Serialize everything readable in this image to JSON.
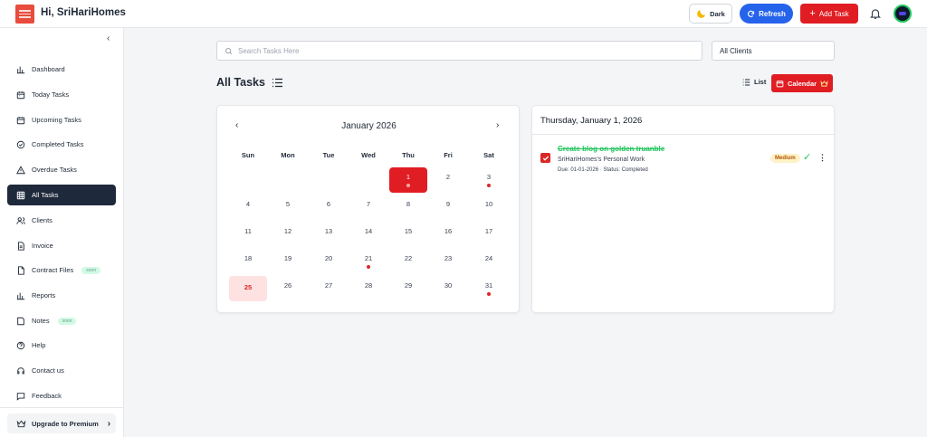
{
  "header": {
    "greeting": "Hi, SriHariHomes",
    "dark_label": "Dark",
    "refresh_label": "Refresh",
    "add_task_label": "Add Task",
    "brand_color": "#e11d24",
    "refresh_color": "#2563eb"
  },
  "sidebar": {
    "items": [
      {
        "label": "Dashboard",
        "icon": "bar-chart-icon"
      },
      {
        "label": "Today Tasks",
        "icon": "calendar-day-icon"
      },
      {
        "label": "Upcoming Tasks",
        "icon": "calendar-icon"
      },
      {
        "label": "Completed Tasks",
        "icon": "check-circle-icon"
      },
      {
        "label": "Overdue Tasks",
        "icon": "warning-icon"
      },
      {
        "label": "All Tasks",
        "icon": "grid-icon",
        "active": true
      },
      {
        "label": "Clients",
        "icon": "users-icon"
      },
      {
        "label": "Invoice",
        "icon": "file-text-icon"
      },
      {
        "label": "Contract Files",
        "icon": "file-icon",
        "badge": "soon"
      },
      {
        "label": "Reports",
        "icon": "bar-chart-icon"
      },
      {
        "label": "Notes",
        "icon": "note-icon",
        "badge": "soon"
      },
      {
        "label": "Help",
        "icon": "help-icon"
      },
      {
        "label": "Contact us",
        "icon": "headset-icon"
      },
      {
        "label": "Feedback",
        "icon": "message-icon"
      }
    ],
    "upgrade_label": "Upgrade to Premium"
  },
  "toolbar": {
    "search_placeholder": "Search Tasks Here",
    "client_filter": "All Clients",
    "page_title": "All Tasks",
    "list_label": "List",
    "calendar_label": "Calendar"
  },
  "calendar": {
    "month_label": "January 2026",
    "weekdays": [
      "Sun",
      "Mon",
      "Tue",
      "Wed",
      "Thu",
      "Fri",
      "Sat"
    ],
    "first_weekday_index": 4,
    "days_in_month": 31,
    "selected_day": 1,
    "highlighted_day": 25,
    "days_with_tasks": [
      1,
      3,
      21,
      31
    ]
  },
  "tasks_panel": {
    "date_heading": "Thursday, January 1, 2026",
    "task": {
      "title": "Create blog on golden truanble",
      "client": "SriHariHomes's Personal Work",
      "due": "Due: 01-01-2026",
      "status": "Status: Completed",
      "priority": "Medium",
      "done_mark": "✓",
      "more": "⋮"
    }
  }
}
